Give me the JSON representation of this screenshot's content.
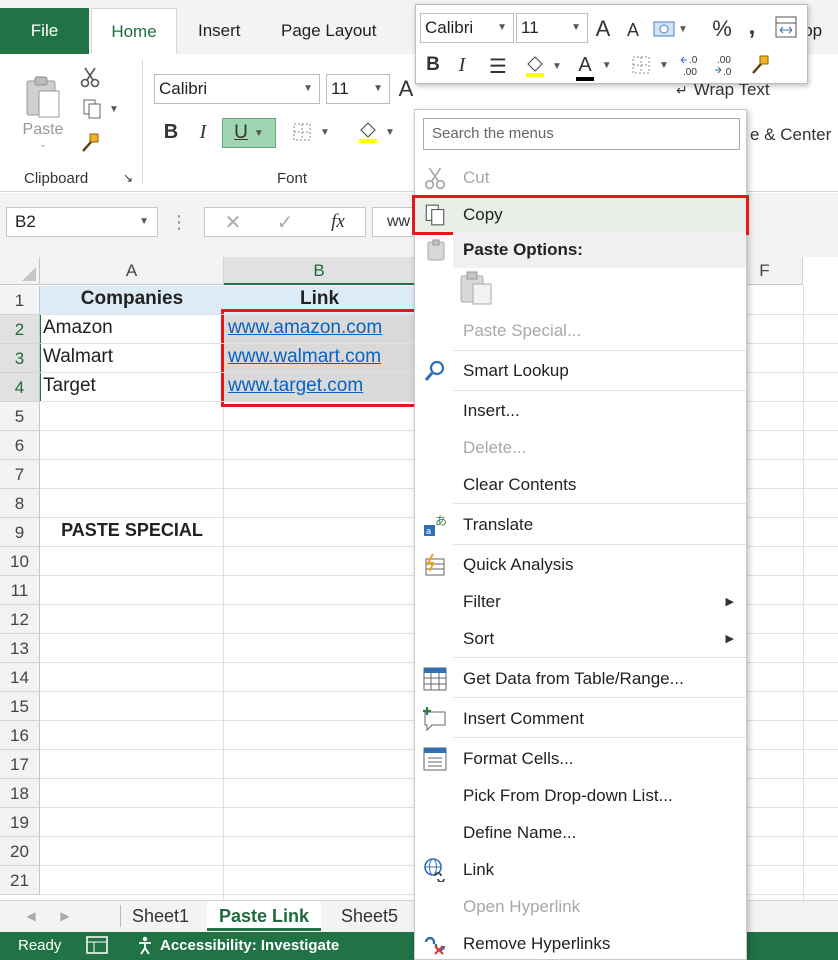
{
  "tabs": {
    "file": "File",
    "home": "Home",
    "insert": "Insert",
    "page_layout": "Page Layout",
    "developer_partial": "elop"
  },
  "ribbon": {
    "clipboard": {
      "label": "Clipboard",
      "paste_label": "Paste"
    },
    "font": {
      "label": "Font",
      "font_name": "Calibri",
      "font_size": "11"
    },
    "alignment": {
      "wrap_text": "Wrap Text",
      "merge_center_partial": "e & Center"
    }
  },
  "formula_bar": {
    "name_box": "B2",
    "formula_partial": "ww"
  },
  "grid": {
    "columns": [
      "A",
      "B",
      "F"
    ],
    "rows": [
      "1",
      "2",
      "3",
      "4",
      "5",
      "6",
      "7",
      "8",
      "9",
      "10",
      "11",
      "12",
      "13",
      "14",
      "15",
      "16",
      "17",
      "18",
      "19",
      "20",
      "21"
    ],
    "cells": {
      "a1": "Companies",
      "b1": "Link",
      "a2": "Amazon",
      "b2": "www.amazon.com",
      "a3": "Walmart",
      "b3": "www.walmart.com",
      "a4": "Target",
      "b4": "www.target.com",
      "a9": "PASTE SPECIAL"
    }
  },
  "sheets": {
    "sheet1": "Sheet1",
    "paste_link": "Paste Link",
    "sheet5": "Sheet5"
  },
  "status": {
    "ready": "Ready",
    "accessibility": "Accessibility: Investigate"
  },
  "mini_toolbar": {
    "font_name": "Calibri",
    "font_size": "11"
  },
  "context_menu": {
    "search_placeholder": "Search the menus",
    "items": {
      "cut": "Cut",
      "copy": "Copy",
      "paste_options": "Paste Options:",
      "paste_special": "Paste Special...",
      "smart_lookup": "Smart Lookup",
      "insert": "Insert...",
      "delete": "Delete...",
      "clear_contents": "Clear Contents",
      "translate": "Translate",
      "quick_analysis": "Quick Analysis",
      "filter": "Filter",
      "sort": "Sort",
      "get_data": "Get Data from Table/Range...",
      "insert_comment": "Insert Comment",
      "format_cells": "Format Cells...",
      "pick_from_list": "Pick From Drop-down List...",
      "define_name": "Define Name...",
      "link": "Link",
      "open_hyperlink": "Open Hyperlink",
      "remove_hyperlinks": "Remove Hyperlinks"
    }
  },
  "icons": {
    "cut": "scissors-icon",
    "copy": "copy-icon",
    "paste": "clipboard-icon",
    "format_painter": "paintbrush-icon",
    "smart_lookup": "search-icon",
    "translate": "translate-icon",
    "quick_analysis": "quick-analysis-icon",
    "get_data": "table-icon",
    "comment": "comment-icon",
    "format_cells": "format-cells-icon",
    "link": "globe-link-icon",
    "remove_hyperlinks": "remove-link-icon"
  },
  "colors": {
    "excel_green": "#217346",
    "link_blue": "#0563c1",
    "highlight_red": "#e8151b",
    "header_fill": "#ddebf7"
  }
}
